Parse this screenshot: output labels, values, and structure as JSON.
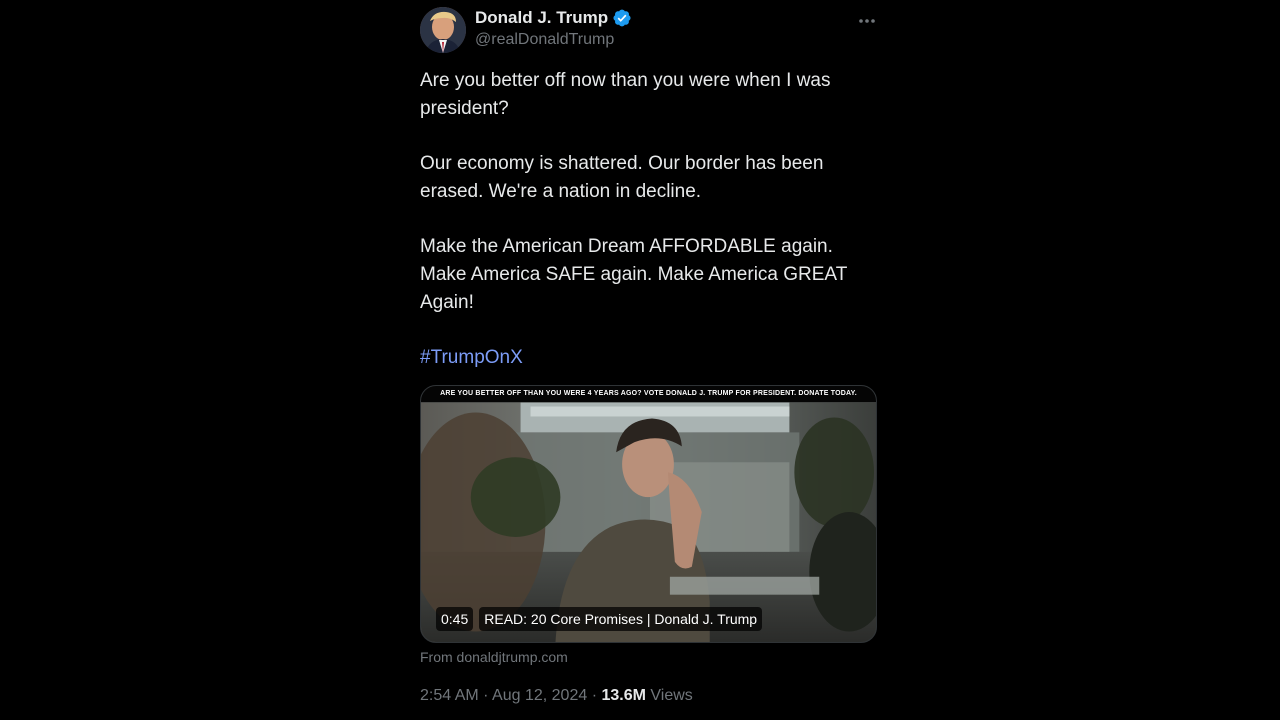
{
  "author": {
    "display_name": "Donald J. Trump",
    "handle": "@realDonaldTrump",
    "verified_icon": "verified-badge-icon",
    "verified_color": "#1d9bf0"
  },
  "menu_icon": "more-horizontal-icon",
  "post": {
    "paragraphs": [
      "Are you better off now than you were when I was president?",
      "Our economy is shattered. Our border has been erased. We're a nation in decline.",
      "Make the American Dream AFFORDABLE again. Make America SAFE again. Make America GREAT Again!"
    ],
    "hashtag": "#TrumpOnX",
    "hashtag_color": "#7c9cf7"
  },
  "media": {
    "banner_text": "ARE YOU BETTER OFF THAN YOU WERE 4 YEARS AGO?  VOTE DONALD J. TRUMP FOR PRESIDENT. DONATE TODAY.",
    "duration": "0:45",
    "title": "READ: 20 Core Promises | Donald J. Trump"
  },
  "source": "From donaldjtrump.com",
  "meta": {
    "time": "2:54 AM",
    "separator": "·",
    "date": "Aug 12, 2024",
    "views_count": "13.6M",
    "views_label": "Views"
  }
}
